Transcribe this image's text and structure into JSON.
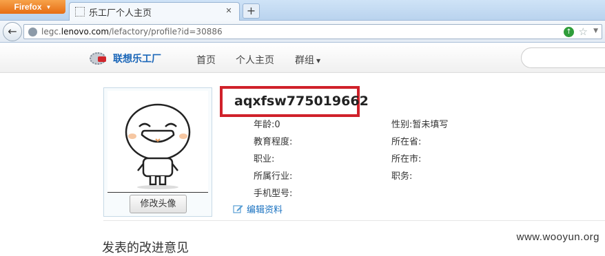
{
  "browser": {
    "menu_button": "Firefox",
    "tab_title": "乐工厂个人主页",
    "url_prefix": "legc.",
    "url_host": "lenovo.com",
    "url_path": "/lefactory/profile?id=30886"
  },
  "site": {
    "logo_text": "联想乐工厂",
    "nav": {
      "home": "首页",
      "profile": "个人主页",
      "groups": "群组"
    }
  },
  "profile": {
    "username": "aqxfsw775019662",
    "change_avatar": "修改头像",
    "fields": {
      "age": "年龄:0",
      "education": "教育程度:",
      "occupation": "职业:",
      "industry": "所属行业:",
      "phone_model": "手机型号:",
      "gender": "性别:暂未填写",
      "province": "所在省:",
      "city": "所在市:",
      "position": "职务:"
    },
    "edit_link": "编辑资料"
  },
  "section": {
    "title": "发表的改进意见"
  },
  "watermark": "www.wooyun.org",
  "colors": {
    "highlight_border": "#d0212a",
    "link": "#1a72c0",
    "firefox_button": "#e66d13"
  },
  "icons": [
    "firefox-menu-icon",
    "back-arrow-icon",
    "globe-icon",
    "go-arrow-icon",
    "bookmark-star-icon",
    "edit-pencil-icon"
  ]
}
